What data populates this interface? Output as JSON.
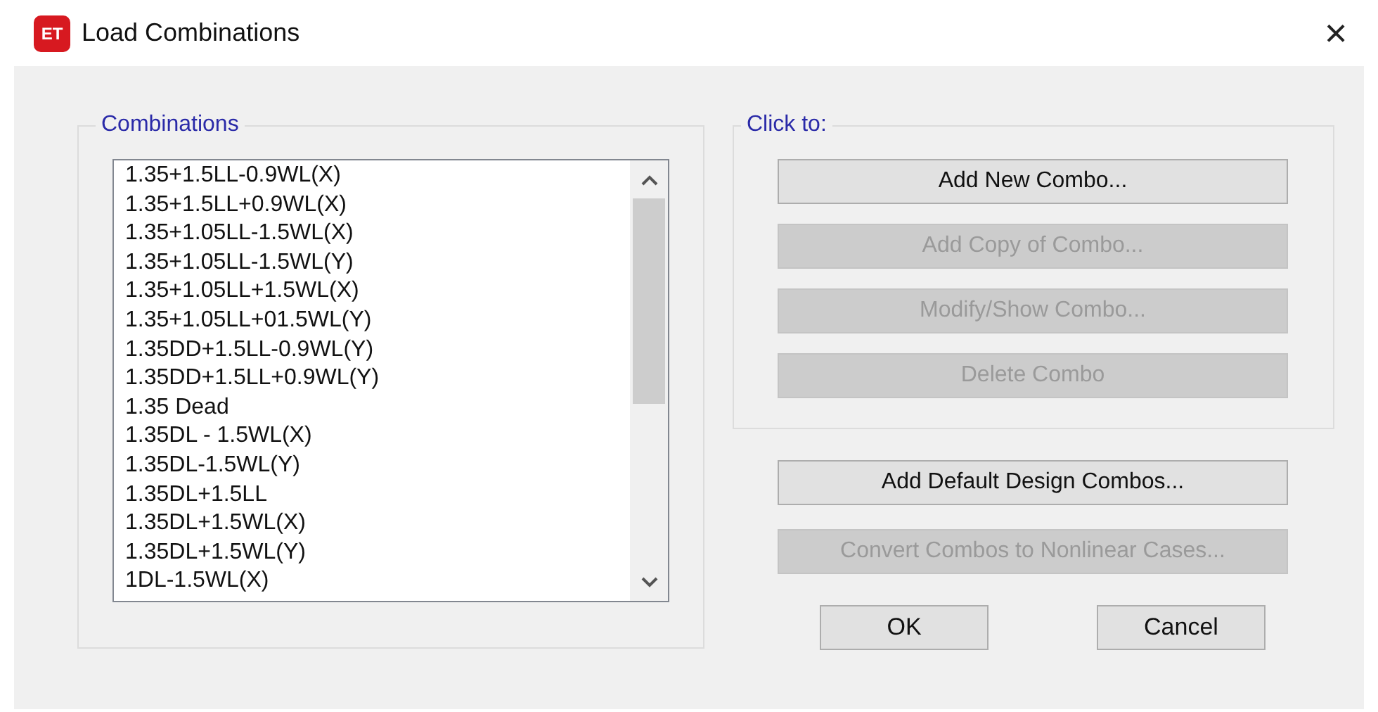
{
  "window": {
    "app_icon": "ET",
    "title": "Load Combinations",
    "close": "×"
  },
  "combinations": {
    "title": "Combinations",
    "items": [
      {
        "label": "1.35+1.5LL-0.9WL(X)"
      },
      {
        "label": "1.35+1.5LL+0.9WL(X)"
      },
      {
        "label": "1.35+1.05LL-1.5WL(X)"
      },
      {
        "label": "1.35+1.05LL-1.5WL(Y)"
      },
      {
        "label": "1.35+1.05LL+1.5WL(X)"
      },
      {
        "label": "1.35+1.05LL+01.5WL(Y)"
      },
      {
        "label": "1.35DD+1.5LL-0.9WL(Y)"
      },
      {
        "label": "1.35DD+1.5LL+0.9WL(Y)"
      },
      {
        "label": "1.35 Dead"
      },
      {
        "label": "1.35DL - 1.5WL(X)"
      },
      {
        "label": "1.35DL-1.5WL(Y)"
      },
      {
        "label": "1.35DL+1.5LL"
      },
      {
        "label": "1.35DL+1.5WL(X)"
      },
      {
        "label": "1.35DL+1.5WL(Y)"
      },
      {
        "label": "1DL-1.5WL(X)"
      }
    ]
  },
  "click_to": {
    "title": "Click to:",
    "buttons": [
      {
        "label": "Add New Combo...",
        "disabled": false
      },
      {
        "label": "Add Copy of Combo...",
        "disabled": true
      },
      {
        "label": "Modify/Show Combo...",
        "disabled": true
      },
      {
        "label": "Delete Combo",
        "disabled": true
      }
    ]
  },
  "extra_buttons": [
    {
      "label": "Add Default Design Combos...",
      "disabled": false
    },
    {
      "label": "Convert Combos to Nonlinear Cases...",
      "disabled": true
    }
  ],
  "dialog_buttons": [
    {
      "label": "OK"
    },
    {
      "label": "Cancel"
    }
  ]
}
